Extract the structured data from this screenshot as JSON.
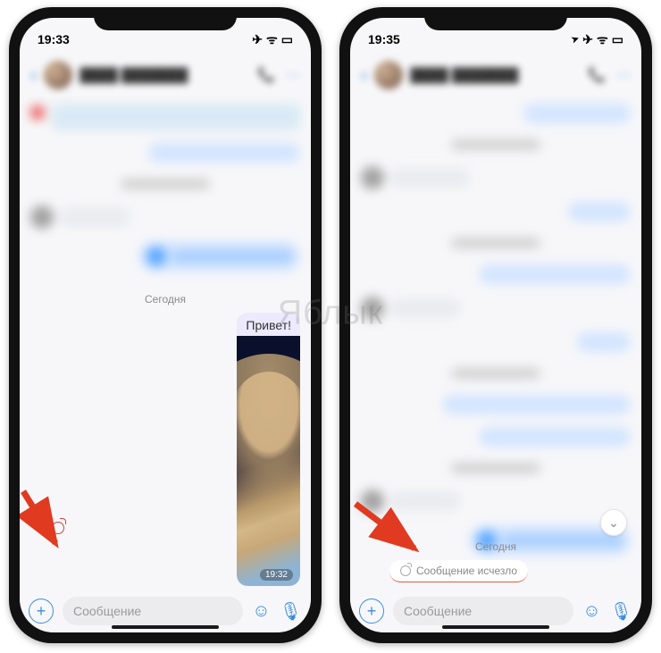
{
  "watermark": "Яблык",
  "left": {
    "status_time": "19:33",
    "today_label": "Сегодня",
    "message_text": "Привет!",
    "message_time": "19:32",
    "input_placeholder": "Сообщение"
  },
  "right": {
    "status_time": "19:35",
    "today_label": "Сегодня",
    "vanished_text": "Сообщение исчезло",
    "input_placeholder": "Сообщение"
  },
  "icons": {
    "airplane": "✈",
    "wifi": "ᯤ",
    "battery": "▭",
    "location": "➤",
    "phone": "📞",
    "more": "⋯",
    "emoji": "☺",
    "mic": "🎙",
    "plus": "+",
    "chevron_down": "⌄"
  }
}
